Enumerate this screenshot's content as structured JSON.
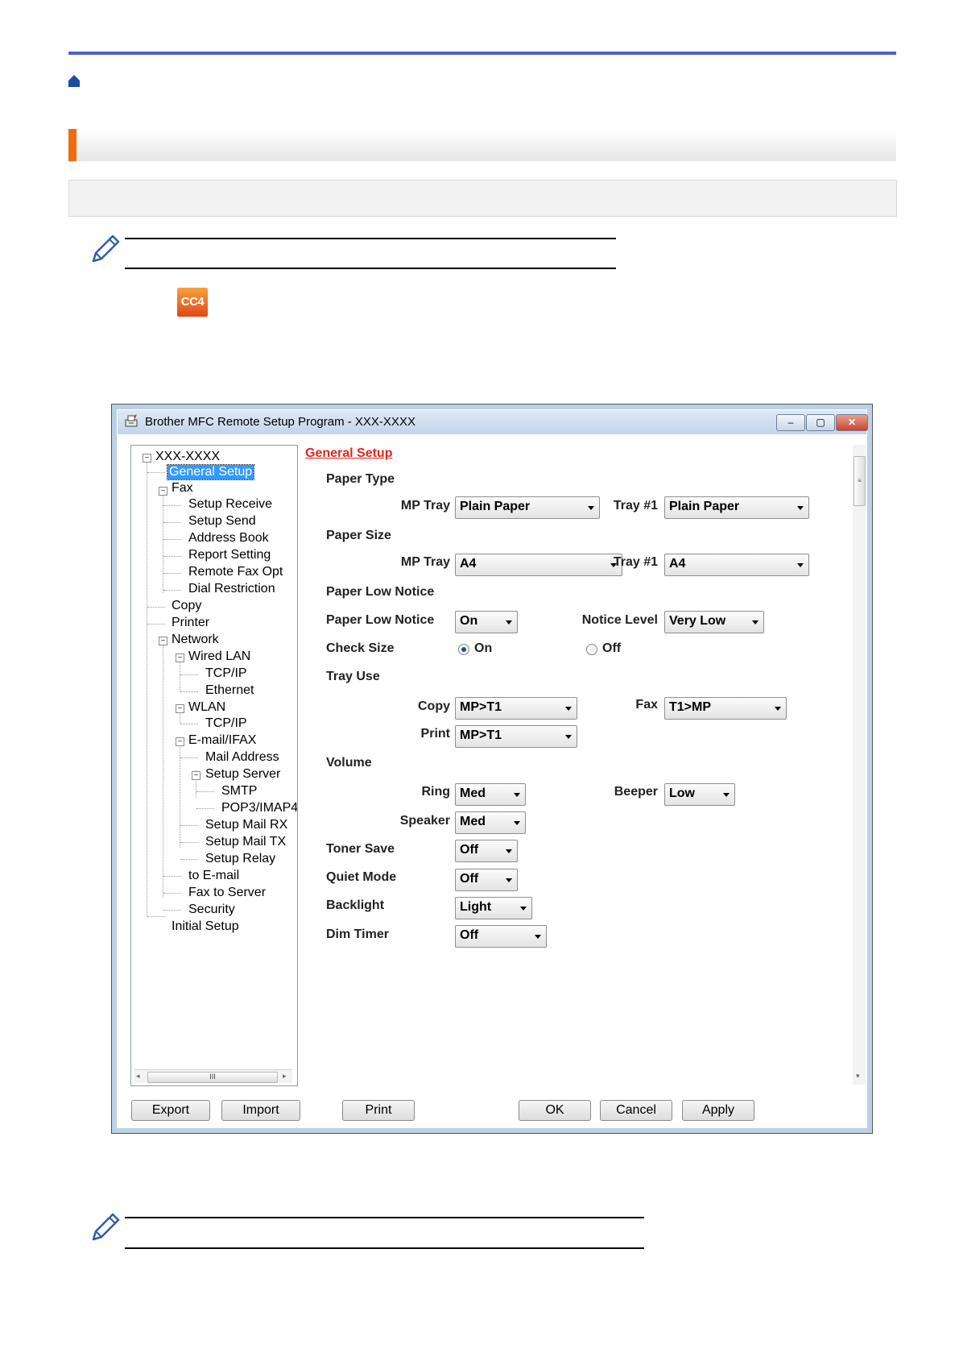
{
  "dialog": {
    "title": "Brother MFC Remote Setup Program - XXX-XXXX",
    "window_buttons": {
      "minimize": "–",
      "maximize": "▢",
      "close": "✕"
    },
    "tree": {
      "root": "XXX-XXXX",
      "items": [
        "General Setup",
        "Fax",
        "Setup Receive",
        "Setup Send",
        "Address Book",
        "Report Setting",
        "Remote Fax Opt",
        "Dial Restriction",
        "Copy",
        "Printer",
        "Network",
        "Wired LAN",
        "TCP/IP",
        "Ethernet",
        "WLAN",
        "TCP/IP",
        "E-mail/IFAX",
        "Mail Address",
        "Setup Server",
        "SMTP",
        "POP3/IMAP4",
        "Setup Mail RX",
        "Setup Mail TX",
        "Setup Relay",
        "to E-mail",
        "Fax to Server",
        "Security",
        "Initial Setup"
      ],
      "selected": "General Setup",
      "scroll_thumb": "III"
    },
    "main": {
      "heading": "General Setup",
      "paper_type": {
        "label": "Paper Type",
        "mp_tray_label": "MP Tray",
        "mp_tray_value": "Plain Paper",
        "tray1_label": "Tray #1",
        "tray1_value": "Plain Paper"
      },
      "paper_size": {
        "label": "Paper Size",
        "mp_tray_label": "MP Tray",
        "mp_tray_value": "A4",
        "tray1_label": "Tray #1",
        "tray1_value": "A4"
      },
      "paper_low_notice": {
        "section_label": "Paper Low Notice",
        "label": "Paper Low Notice",
        "value": "On",
        "level_label": "Notice Level",
        "level_value": "Very Low"
      },
      "check_size": {
        "label": "Check Size",
        "on_label": "On",
        "off_label": "Off",
        "selected": "On"
      },
      "tray_use": {
        "label": "Tray Use",
        "copy_label": "Copy",
        "copy_value": "MP>T1",
        "fax_label": "Fax",
        "fax_value": "T1>MP",
        "print_label": "Print",
        "print_value": "MP>T1"
      },
      "volume": {
        "label": "Volume",
        "ring_label": "Ring",
        "ring_value": "Med",
        "beeper_label": "Beeper",
        "beeper_value": "Low",
        "speaker_label": "Speaker",
        "speaker_value": "Med"
      },
      "toner_save": {
        "label": "Toner Save",
        "value": "Off"
      },
      "quiet_mode": {
        "label": "Quiet Mode",
        "value": "Off"
      },
      "backlight": {
        "label": "Backlight",
        "value": "Light"
      },
      "dim_timer": {
        "label": "Dim Timer",
        "value": "Off"
      }
    },
    "buttons": {
      "export": "Export",
      "import": "Import",
      "print": "Print",
      "ok": "OK",
      "cancel": "Cancel",
      "apply": "Apply"
    }
  },
  "icon_badge": "CC4",
  "colors": {
    "accent_orange": "#f06a14",
    "header_blue": "#4f5fd0",
    "selection": "#3399ff",
    "link_red": "#e0261c"
  }
}
